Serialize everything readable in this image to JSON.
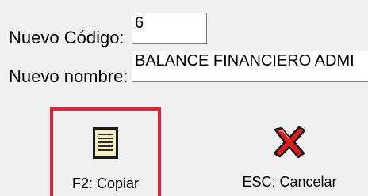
{
  "form": {
    "code_label": "Nuevo Código:",
    "code_value": "6",
    "name_label": "Nuevo nombre:",
    "name_value": "BALANCE FINANCIERO ADMI"
  },
  "buttons": {
    "copy_label": "F2: Copiar",
    "copy_icon": "document-icon",
    "cancel_label": "ESC: Cancelar",
    "cancel_icon": "red-x-icon"
  },
  "colors": {
    "highlight": "#d8283a",
    "background": "#f0f0f0"
  }
}
